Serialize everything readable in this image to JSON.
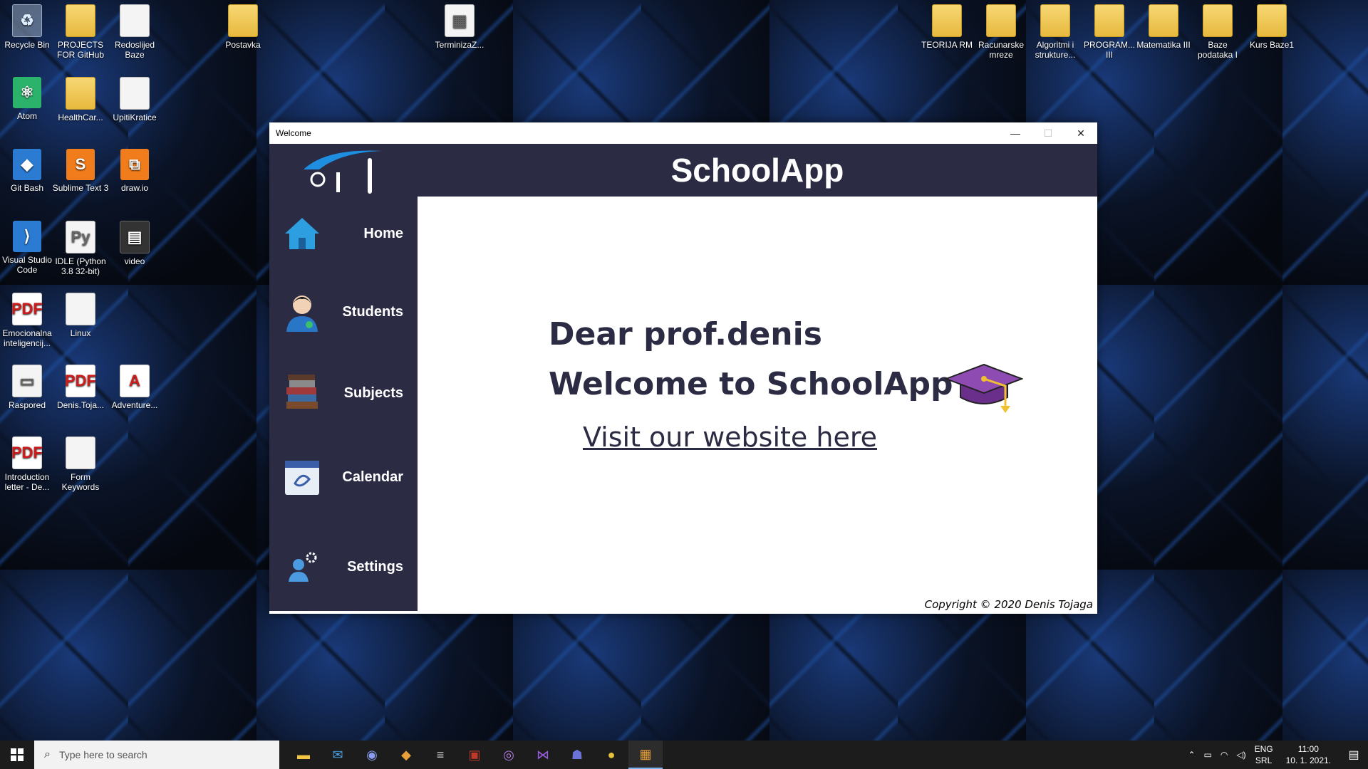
{
  "desktop": {
    "icons": [
      {
        "label": "Recycle Bin",
        "glyph": "♻",
        "kind": "recycle"
      },
      {
        "label": "PROJECTS FOR GitHub",
        "glyph": "",
        "kind": "folder"
      },
      {
        "label": "Redoslijed Baze",
        "glyph": "",
        "kind": "doc"
      },
      {
        "label": "Postavka",
        "glyph": "",
        "kind": "folder"
      },
      {
        "label": "TerminizaZ...",
        "glyph": "▦",
        "kind": "doc"
      },
      {
        "label": "TEORIJA RM",
        "glyph": "",
        "kind": "folder"
      },
      {
        "label": "Racunarske mreze",
        "glyph": "",
        "kind": "folder"
      },
      {
        "label": "Algoritmi i strukture...",
        "glyph": "",
        "kind": "folder"
      },
      {
        "label": "PROGRAM... III",
        "glyph": "",
        "kind": "folder"
      },
      {
        "label": "Matematika III",
        "glyph": "",
        "kind": "folder"
      },
      {
        "label": "Baze podataka I",
        "glyph": "",
        "kind": "folder"
      },
      {
        "label": "Kurs Baze1",
        "glyph": "",
        "kind": "folder"
      },
      {
        "label": "Atom",
        "glyph": "⚛",
        "kind": "green"
      },
      {
        "label": "HealthCar...",
        "glyph": "",
        "kind": "folder"
      },
      {
        "label": "UpitiKratice",
        "glyph": "",
        "kind": "doc"
      },
      {
        "label": "Git Bash",
        "glyph": "◆",
        "kind": "app"
      },
      {
        "label": "Sublime Text 3",
        "glyph": "S",
        "kind": "orange"
      },
      {
        "label": "draw.io",
        "glyph": "⧉",
        "kind": "orange"
      },
      {
        "label": "Visual Studio Code",
        "glyph": "⟩",
        "kind": "app"
      },
      {
        "label": "IDLE (Python 3.8 32-bit)",
        "glyph": "Py",
        "kind": "doc"
      },
      {
        "label": "video",
        "glyph": "▤",
        "kind": "dark"
      },
      {
        "label": "Emocionalna inteligencij...",
        "glyph": "PDF",
        "kind": "pdf"
      },
      {
        "label": "Linux",
        "glyph": "",
        "kind": "doc"
      },
      {
        "label": "Raspored",
        "glyph": "▭",
        "kind": "doc"
      },
      {
        "label": "Denis.Toja...",
        "glyph": "PDF",
        "kind": "pdf"
      },
      {
        "label": "Adventure...",
        "glyph": "A",
        "kind": "pdf"
      },
      {
        "label": "Introduction letter - De...",
        "glyph": "PDF",
        "kind": "pdf"
      },
      {
        "label": "Form Keywords",
        "glyph": "",
        "kind": "doc"
      }
    ]
  },
  "window": {
    "title": "Welcome",
    "minimize": "—",
    "maximize": "☐",
    "close": "✕"
  },
  "app": {
    "title": "SchoolApp",
    "nav": [
      {
        "label": "Home",
        "icon": "house-icon"
      },
      {
        "label": "Students",
        "icon": "student-icon"
      },
      {
        "label": "Subjects",
        "icon": "books-icon"
      },
      {
        "label": "Calendar",
        "icon": "calendar-icon"
      },
      {
        "label": "Settings",
        "icon": "user-gear-icon"
      }
    ],
    "greeting": "Dear prof.denis",
    "welcome": "Welcome to SchoolApp",
    "website_link": "Visit our website here",
    "copyright": "Copyright © 2020 Denis Tojaga",
    "colors": {
      "sidebar": "#2b2b44",
      "accent": "#7b3fa0"
    }
  },
  "taskbar": {
    "search_placeholder": "Type here to search",
    "lang": "ENG",
    "layout": "SRL",
    "time": "11:00",
    "date": "10. 1. 2021."
  }
}
